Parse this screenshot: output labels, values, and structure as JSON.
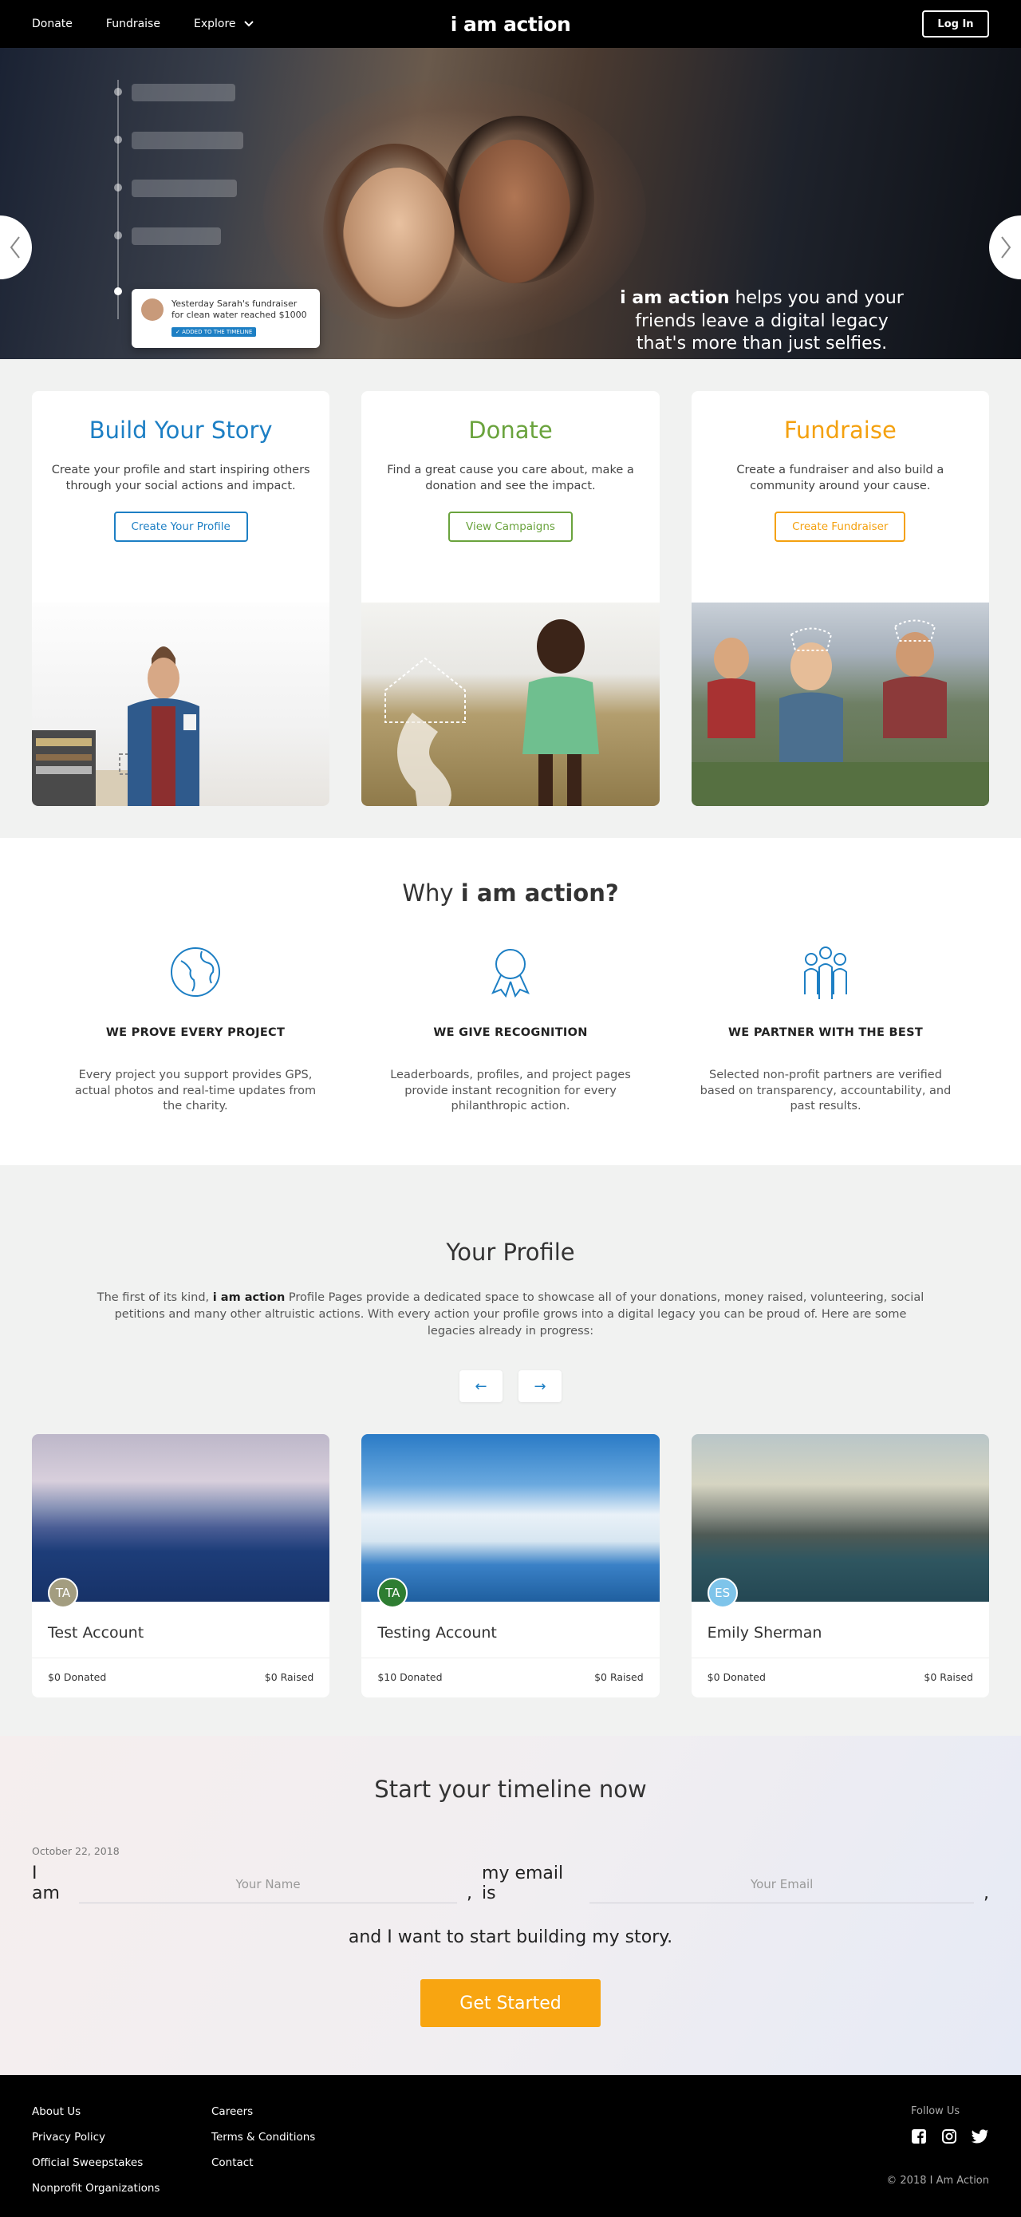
{
  "nav": {
    "donate": "Donate",
    "fundraise": "Fundraise",
    "explore": "Explore",
    "logo": "i am action",
    "login": "Log In"
  },
  "hero": {
    "card_text": "Yesterday Sarah's fundraiser for clean water reached $1000",
    "card_badge": "✓ ADDED TO THE TIMELINE",
    "headline_bold": "i am action",
    "headline_rest": " helps you and your friends leave a digital legacy that's more than just selfies.",
    "active_slide": 3,
    "slide_count": 3
  },
  "actions": [
    {
      "title": "Build Your Story",
      "text": "Create your profile and start inspiring others through your social actions and impact.",
      "button": "Create Your Profile",
      "color": "#1d7fc4"
    },
    {
      "title": "Donate",
      "text": "Find a great cause you care about, make a donation and see the impact.",
      "button": "View Campaigns",
      "color": "#6aa33d"
    },
    {
      "title": "Fundraise",
      "text": "Create a fundraiser and also build a community around your cause.",
      "button": "Create Fundraiser",
      "color": "#f4a10f"
    }
  ],
  "why": {
    "title_prefix": "Why ",
    "title_bold": "i am action?",
    "items": [
      {
        "heading": "WE PROVE EVERY PROJECT",
        "text": "Every project you support provides GPS, actual photos and real-time updates from the charity.",
        "icon": "globe-icon"
      },
      {
        "heading": "WE GIVE RECOGNITION",
        "text": "Leaderboards, profiles, and project pages provide instant recognition for every philanthropic action.",
        "icon": "ribbon-icon"
      },
      {
        "heading": "WE PARTNER WITH THE BEST",
        "text": "Selected non-profit partners are verified based on transparency, accountability, and past results.",
        "icon": "people-icon"
      }
    ]
  },
  "profile": {
    "title": "Your Profile",
    "desc_prefix": "The first of its kind, ",
    "desc_bold": "i am action",
    "desc_rest": " Profile Pages provide a dedicated space to showcase all of your donations, money raised, volunteering, social petitions and many other altruistic actions. With every action your profile grows into a digital legacy you can be proud of. Here are some legacies already in progress:",
    "prev": "←",
    "next": "→",
    "cards": [
      {
        "initials": "TA",
        "name": "Test Account",
        "donated": "$0 Donated",
        "raised": "$0 Raised",
        "avatar_color": "#a39d80"
      },
      {
        "initials": "TA",
        "name": "Testing Account",
        "donated": "$10 Donated",
        "raised": "$0 Raised",
        "avatar_color": "#2e7d32"
      },
      {
        "initials": "ES",
        "name": "Emily Sherman",
        "donated": "$0 Donated",
        "raised": "$0 Raised",
        "avatar_color": "#7ec4ea"
      }
    ]
  },
  "start": {
    "title": "Start your timeline now",
    "date": "October 22, 2018",
    "i_am": "I am",
    "name_placeholder": "Your Name",
    "comma1": ",",
    "my_email_is": "my email is",
    "email_placeholder": "Your Email",
    "comma2": ",",
    "line2": "and I want to start building my story.",
    "button": "Get Started"
  },
  "footer": {
    "col1": [
      "About Us",
      "Privacy Policy",
      "Official Sweepstakes",
      "Nonprofit Organizations"
    ],
    "col2": [
      "Careers",
      "Terms & Conditions",
      "Contact"
    ],
    "follow_label": "Follow Us",
    "copyright": "© 2018 I Am Action"
  }
}
